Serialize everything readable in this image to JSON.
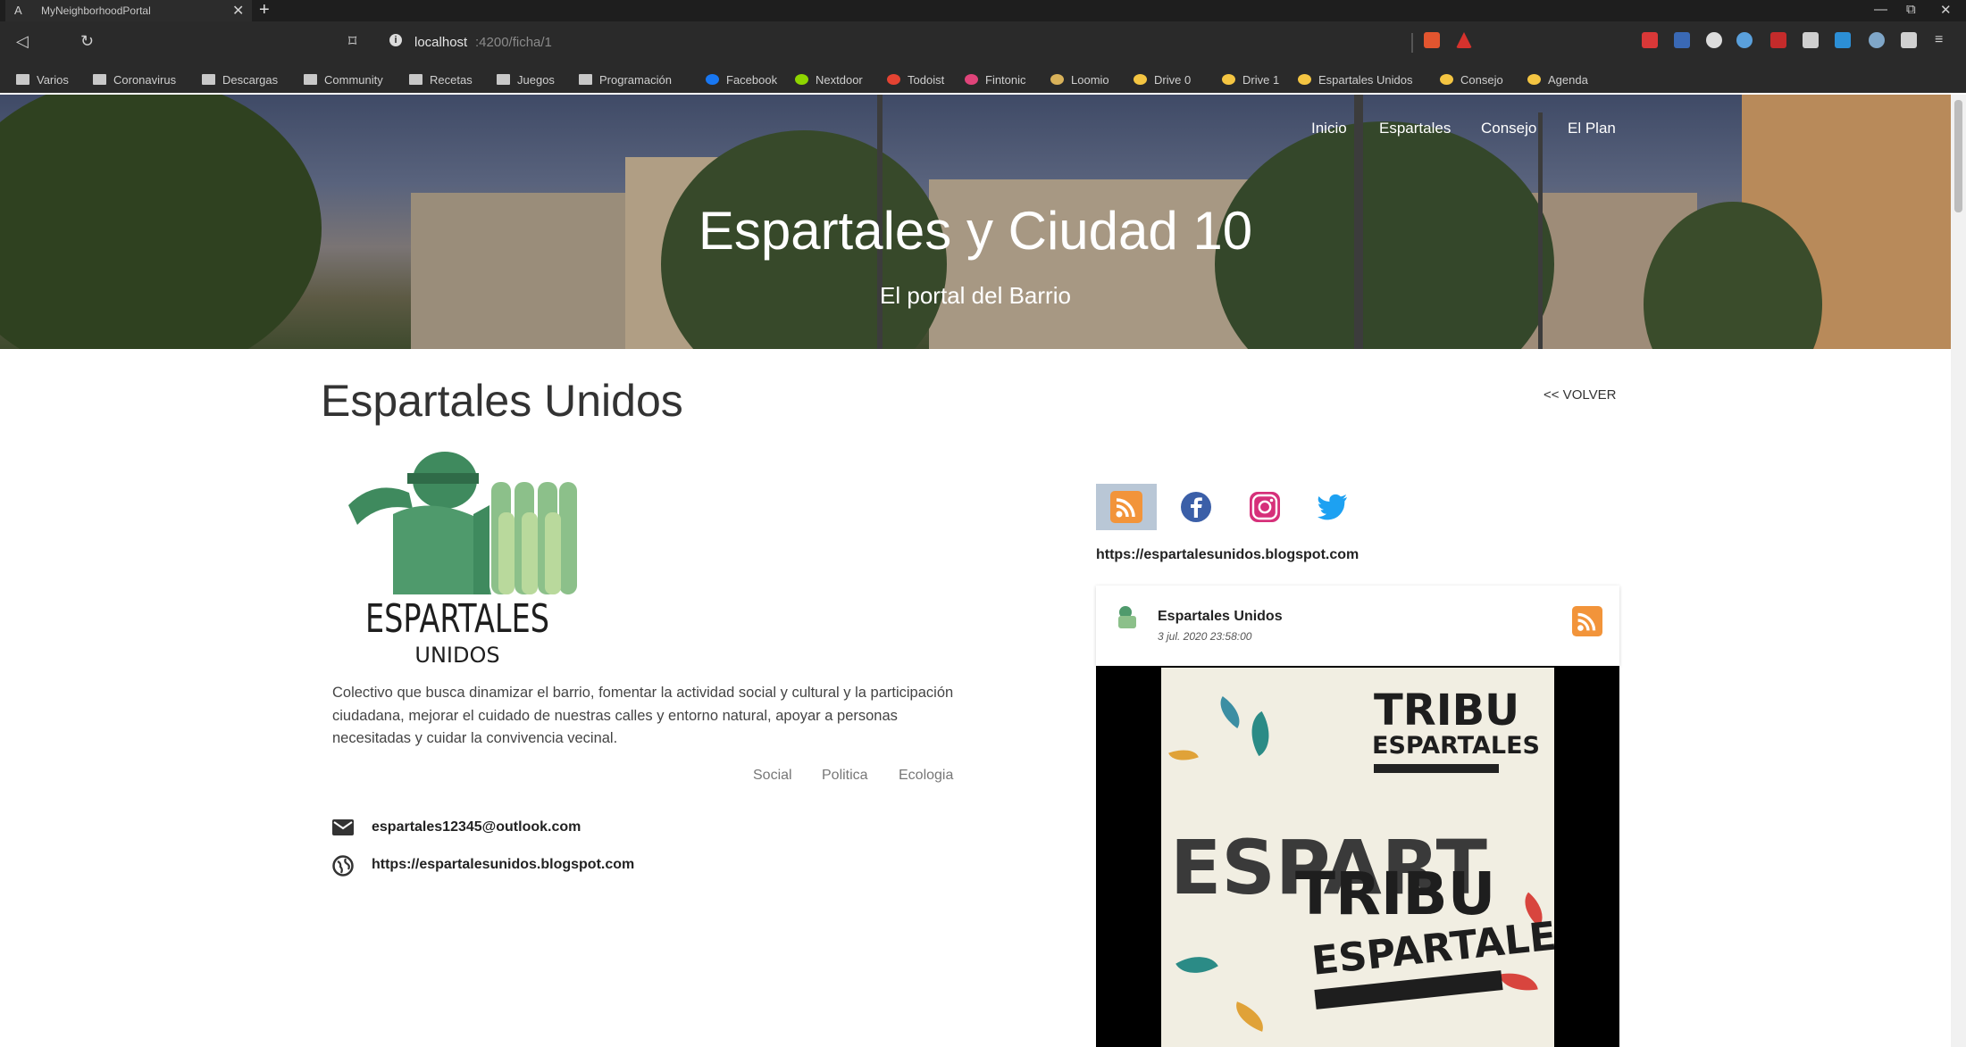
{
  "browser": {
    "tab_icon": "A",
    "tab_title": "MyNeighborhoodPortal",
    "tab_close": "✕",
    "new_tab": "+",
    "window_controls": {
      "minimize": "—",
      "restore": "⧉",
      "close": "✕"
    },
    "nav": {
      "back": "◁",
      "reload": "↻",
      "bookmark": "⌑"
    },
    "url_host": "localhost",
    "url_path": ":4200/ficha/1",
    "bookmarks": [
      {
        "label": "Varios",
        "icon": "folder-icon"
      },
      {
        "label": "Coronavirus",
        "icon": "folder-icon"
      },
      {
        "label": "Descargas",
        "icon": "folder-icon"
      },
      {
        "label": "Community",
        "icon": "folder-icon"
      },
      {
        "label": "Recetas",
        "icon": "folder-icon"
      },
      {
        "label": "Juegos",
        "icon": "folder-icon"
      },
      {
        "label": "Programación",
        "icon": "folder-icon"
      },
      {
        "label": "Facebook",
        "icon": "facebook-icon"
      },
      {
        "label": "Nextdoor",
        "icon": "nextdoor-icon"
      },
      {
        "label": "Todoist",
        "icon": "todoist-icon"
      },
      {
        "label": "Fintonic",
        "icon": "fintonic-icon"
      },
      {
        "label": "Loomio",
        "icon": "loomio-icon"
      },
      {
        "label": "Drive 0",
        "icon": "drive-icon"
      },
      {
        "label": "Drive 1",
        "icon": "drive-icon"
      },
      {
        "label": "Espartales Unidos",
        "icon": "drive-icon"
      },
      {
        "label": "Consejo",
        "icon": "drive-icon"
      },
      {
        "label": "Agenda",
        "icon": "drive-icon"
      }
    ]
  },
  "header": {
    "title": "Espartales y Ciudad 10",
    "subtitle": "El portal del Barrio",
    "nav": [
      "Inicio",
      "Espartales",
      "Consejo",
      "El Plan"
    ]
  },
  "main": {
    "title": "Espartales Unidos",
    "back": "<< VOLVER",
    "logo_text": "ESPARTALES",
    "logo_subtext": "UNIDOS",
    "description": "Colectivo que busca dinamizar el barrio, fomentar la actividad social y cultural y la participación ciudadana, mejorar el cuidado de nuestras calles y entorno natural, apoyar a personas necesitadas y cuidar la convivencia vecinal.",
    "tags": [
      "Social",
      "Politica",
      "Ecologia"
    ],
    "email": "espartales12345@outlook.com",
    "website": "https://espartalesunidos.blogspot.com"
  },
  "feed": {
    "url": "https://espartalesunidos.blogspot.com",
    "author": "Espartales Unidos",
    "date": "3 jul. 2020 23:58:00",
    "poster_line1": "TRIBU",
    "poster_line2": "ESPARTALES",
    "poster_big": "ESPART",
    "poster_line3": "TRIBU",
    "poster_line4": "ESPARTALES"
  },
  "colors": {
    "rss": "#f2943a",
    "facebook": "#1877f2",
    "twitter": "#1da1f2",
    "instagram": "#c13584",
    "logo_green": "#4f9a6c"
  }
}
